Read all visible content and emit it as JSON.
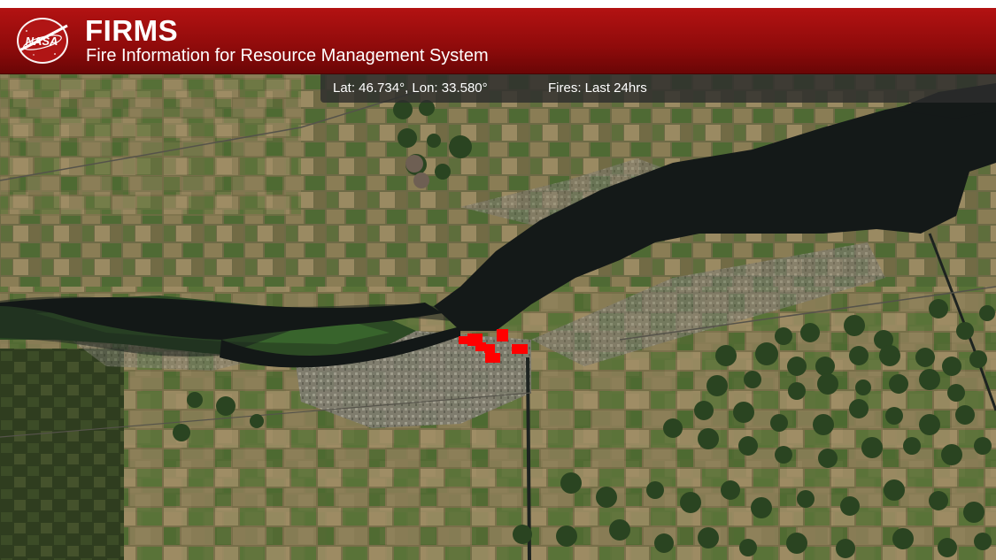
{
  "header": {
    "logo_text": "NASA",
    "title": "FIRMS",
    "subtitle": "Fire Information for Resource Management System"
  },
  "infobar": {
    "coordinates": "Lat: 46.734°, Lon: 33.580°",
    "fires_filter": "Fires: Last 24hrs"
  },
  "colors": {
    "header_red": "#a50f0f",
    "fire_detection": "#ff0000",
    "water": "#14191a",
    "farmland": "#6f6a45"
  },
  "map": {
    "imagery": "satellite",
    "fire_markers": 7
  }
}
